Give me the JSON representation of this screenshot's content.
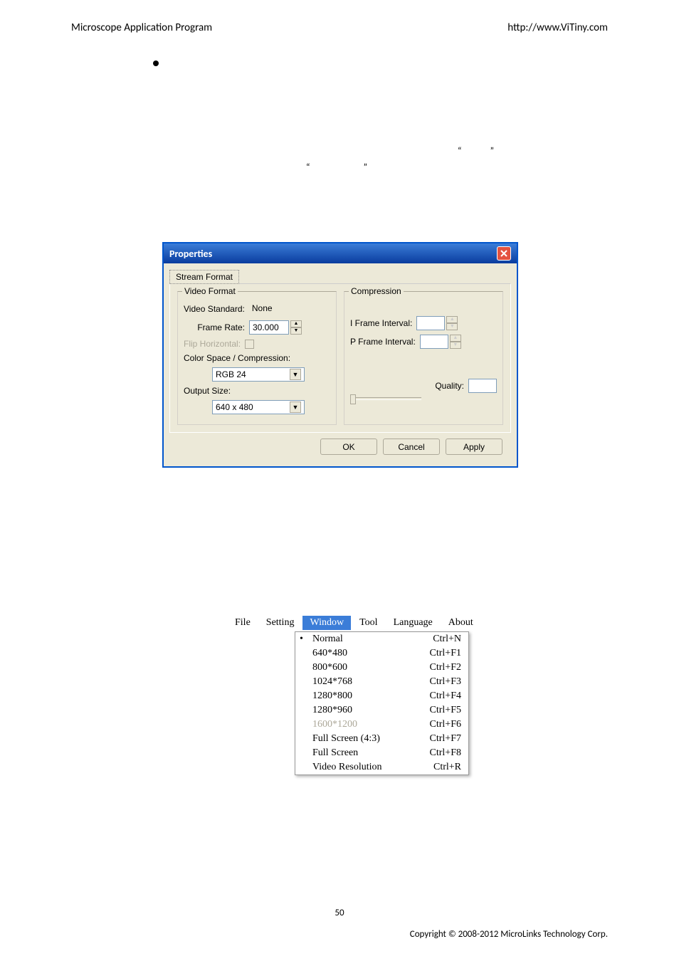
{
  "header": {
    "left": "Microscope Application Program",
    "right": "http://www.ViTiny.com"
  },
  "dialog": {
    "title": "Properties",
    "tab": "Stream Format",
    "groups": {
      "video_format": {
        "title": "Video Format",
        "video_standard_label": "Video Standard:",
        "video_standard_value": "None",
        "frame_rate_label": "Frame Rate:",
        "frame_rate_value": "30.000",
        "flip_label": "Flip Horizontal:",
        "color_space_label": "Color Space / Compression:",
        "color_space_value": "RGB 24",
        "output_size_label": "Output Size:",
        "output_size_value": "640 x 480"
      },
      "compression": {
        "title": "Compression",
        "i_frame_label": "I Frame Interval:",
        "p_frame_label": "P Frame Interval:",
        "quality_label": "Quality:"
      }
    },
    "buttons": {
      "ok": "OK",
      "cancel": "Cancel",
      "apply": "Apply"
    }
  },
  "menubar": {
    "items": [
      "File",
      "Setting",
      "Window",
      "Tool",
      "Language",
      "About"
    ],
    "active_index": 2
  },
  "menu": {
    "items": [
      {
        "label": "Normal",
        "shortcut": "Ctrl+N",
        "checked": true,
        "disabled": false
      },
      {
        "label": "640*480",
        "shortcut": "Ctrl+F1",
        "checked": false,
        "disabled": false
      },
      {
        "label": "800*600",
        "shortcut": "Ctrl+F2",
        "checked": false,
        "disabled": false
      },
      {
        "label": "1024*768",
        "shortcut": "Ctrl+F3",
        "checked": false,
        "disabled": false
      },
      {
        "label": "1280*800",
        "shortcut": "Ctrl+F4",
        "checked": false,
        "disabled": false
      },
      {
        "label": "1280*960",
        "shortcut": "Ctrl+F5",
        "checked": false,
        "disabled": false
      },
      {
        "label": "1600*1200",
        "shortcut": "Ctrl+F6",
        "checked": false,
        "disabled": true
      },
      {
        "label": "Full Screen (4:3)",
        "shortcut": "Ctrl+F7",
        "checked": false,
        "disabled": false
      },
      {
        "label": "Full Screen",
        "shortcut": "Ctrl+F8",
        "checked": false,
        "disabled": false
      },
      {
        "label": "Video Resolution",
        "shortcut": "Ctrl+R",
        "checked": false,
        "disabled": false
      }
    ]
  },
  "page_number": "50",
  "footer": "Copyright © 2008-2012 MicroLinks Technology Corp."
}
